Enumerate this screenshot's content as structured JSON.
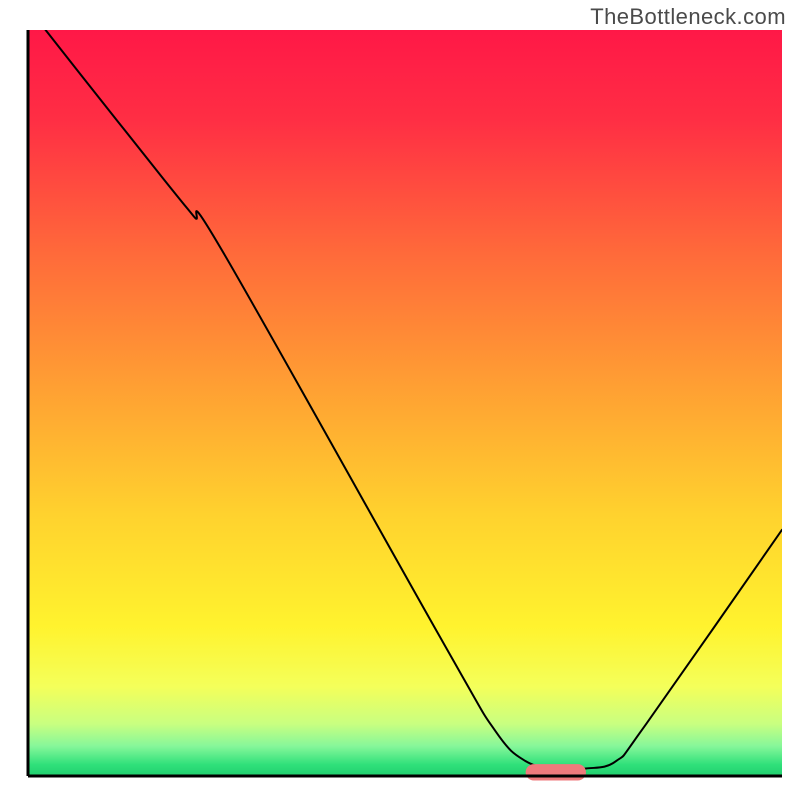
{
  "watermark": "TheBottleneck.com",
  "chart_data": {
    "type": "line",
    "title": "",
    "xlabel": "",
    "ylabel": "",
    "xlim": [
      0,
      100
    ],
    "ylim": [
      0,
      100
    ],
    "grid": false,
    "legend": false,
    "background": {
      "type": "gradient-vertical",
      "stops": [
        {
          "offset": 0.0,
          "color": "#ff1847"
        },
        {
          "offset": 0.12,
          "color": "#ff2e44"
        },
        {
          "offset": 0.3,
          "color": "#ff6a3a"
        },
        {
          "offset": 0.48,
          "color": "#ffa033"
        },
        {
          "offset": 0.65,
          "color": "#ffd22e"
        },
        {
          "offset": 0.8,
          "color": "#fff32e"
        },
        {
          "offset": 0.88,
          "color": "#f4ff5a"
        },
        {
          "offset": 0.93,
          "color": "#c9ff80"
        },
        {
          "offset": 0.96,
          "color": "#86f79a"
        },
        {
          "offset": 0.985,
          "color": "#2fe07a"
        },
        {
          "offset": 1.0,
          "color": "#21cf6f"
        }
      ]
    },
    "series": [
      {
        "name": "bottleneck-curve",
        "color": "#000000",
        "stroke_width": 2,
        "x": [
          0,
          7,
          18,
          22,
          26,
          55,
          62,
          66,
          70,
          74,
          78,
          82,
          100
        ],
        "values": [
          103,
          94,
          80,
          75,
          70,
          18,
          6,
          2,
          1,
          1,
          2,
          7,
          33
        ]
      }
    ],
    "markers": [
      {
        "name": "optimal-range",
        "shape": "rounded-bar",
        "color": "#ef7a7c",
        "x_start": 66,
        "x_end": 74,
        "y": 0.5,
        "height": 2.2
      }
    ],
    "axes_color": "#000000"
  }
}
